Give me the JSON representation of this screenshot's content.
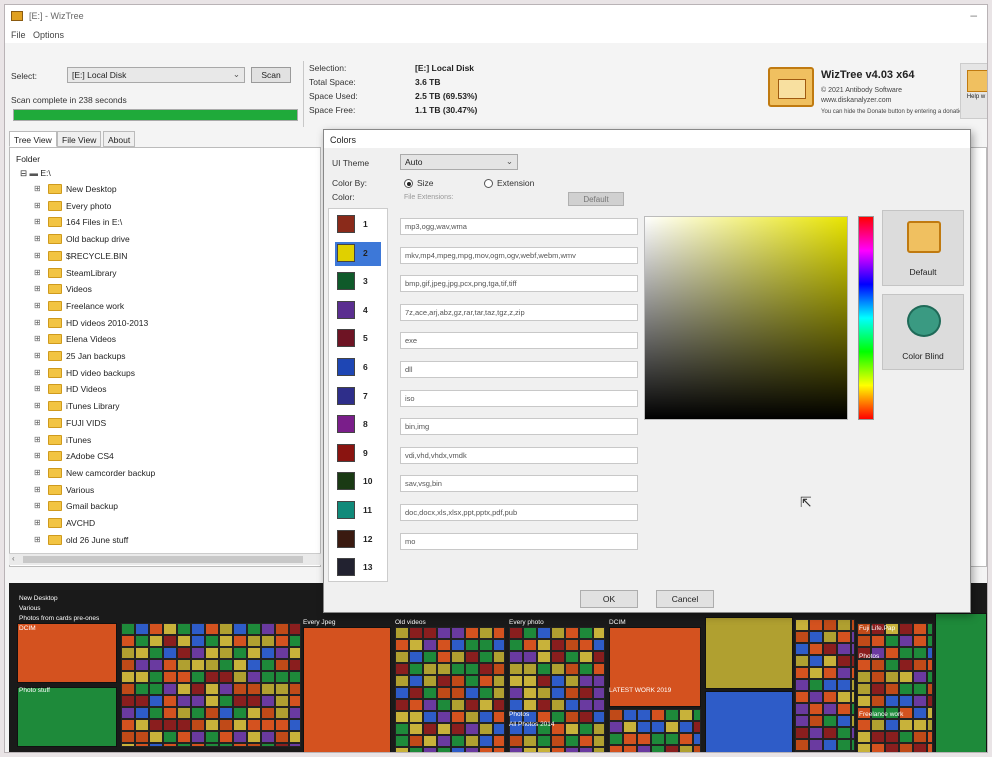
{
  "window": {
    "title": "[E:] - WizTree"
  },
  "menu": [
    "File",
    "Options"
  ],
  "toolbar": {
    "select_label": "Select:",
    "drive_value": "[E:] Local Disk",
    "scan_label": "Scan",
    "status": "Scan complete in 238 seconds",
    "progress": 1.0
  },
  "selection": {
    "labels": [
      "Selection:",
      "Total Space:",
      "Space Used:",
      "Space Free:"
    ],
    "values": [
      "[E:]  Local Disk",
      "3.6 TB",
      "2.5 TB  (69.53%)",
      "1.1 TB  (30.47%)"
    ]
  },
  "brand": {
    "name": "WizTree v4.03 x64",
    "copyright": "© 2021 Antibody Software",
    "url": "www.diskanalyzer.com",
    "note": "You can hide the Donate button by entering a donation",
    "help": "Help w"
  },
  "tabs": [
    "Tree View",
    "File View",
    "About"
  ],
  "tree": {
    "header": "Folder",
    "root": "E:\\",
    "items": [
      "New Desktop",
      "Every photo",
      "164 Files in E:\\",
      "Old backup drive",
      "$RECYCLE.BIN",
      "SteamLibrary",
      "Videos",
      "Freelance work",
      "HD videos 2010-2013",
      "Elena Videos",
      "25 Jan backups",
      "HD video backups",
      "HD Videos",
      "iTunes Library",
      "FUJI VIDS",
      "iTunes",
      "zAdobe CS4",
      "New camcorder backup",
      "Various",
      "Gmail backup",
      "AVCHD",
      "old 26 June stuff"
    ]
  },
  "dialog": {
    "title": "Colors",
    "ui_theme_label": "UI Theme",
    "ui_theme_value": "Auto",
    "color_by_label": "Color By:",
    "size_option": "Size",
    "extension_option": "Extension",
    "color_label": "Color:",
    "file_extensions_label": "File Extensions:",
    "default_button": "Default",
    "swatches": [
      {
        "num": "1",
        "color": "#8a2a1a",
        "ext": "mp3,ogg,wav,wma"
      },
      {
        "num": "2",
        "color": "#e0d000",
        "ext": "mkv,mp4,mpeg,mpg,mov,ogm,ogv,webf,webm,wmv"
      },
      {
        "num": "3",
        "color": "#0f5a2a",
        "ext": "bmp,gif,jpeg,jpg,pcx,png,tga,tif,tiff"
      },
      {
        "num": "4",
        "color": "#5a2e90",
        "ext": "7z,ace,arj,abz,gz,rar,tar,taz,tgz,z,zip"
      },
      {
        "num": "5",
        "color": "#6e1424",
        "ext": "exe"
      },
      {
        "num": "6",
        "color": "#1e46b4",
        "ext": "dll"
      },
      {
        "num": "7",
        "color": "#2e2e8a",
        "ext": "iso"
      },
      {
        "num": "8",
        "color": "#7a1e8a",
        "ext": "bin,img"
      },
      {
        "num": "9",
        "color": "#8a1410",
        "ext": "vdi,vhd,vhdx,vmdk"
      },
      {
        "num": "10",
        "color": "#1a3a14",
        "ext": "sav,vsg,bin"
      },
      {
        "num": "11",
        "color": "#108a7a",
        "ext": "doc,docx,xls,xlsx,ppt,pptx,pdf,pub"
      },
      {
        "num": "12",
        "color": "#3a1a10",
        "ext": "mo"
      },
      {
        "num": "13",
        "color": "#222230",
        "ext": ""
      }
    ],
    "selected_index": 1,
    "presets": [
      "Default",
      "Color Blind"
    ],
    "ok": "OK",
    "cancel": "Cancel"
  },
  "treemap_labels": [
    "New Desktop",
    "Various",
    "Photos from cards pre-ones",
    "DCIM",
    "Photo stuff",
    "Every Jpeg",
    "Old videos",
    "Every photo",
    "DCIM",
    "LATEST WORK 2019",
    "Photos",
    "All Photos 2014",
    "Fuji Life.Pap",
    "Photos",
    "Freelance work"
  ]
}
